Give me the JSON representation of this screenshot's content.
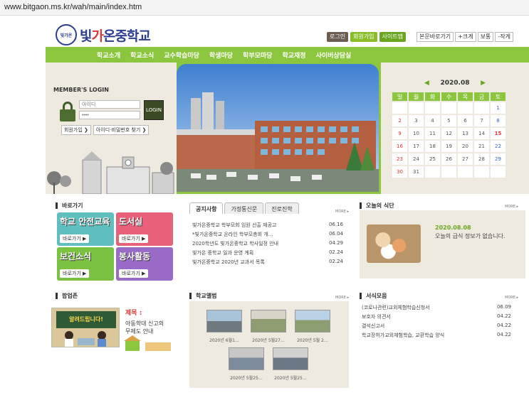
{
  "url": "www.bitgaon.ms.kr/wah/main/index.htm",
  "logo": {
    "emblem": "빛가온",
    "name_a": "빛",
    "name_b": "가",
    "name_c": "온중학교"
  },
  "top_links": [
    "로그인",
    "회원가입",
    "사이트맵"
  ],
  "tools": [
    "본문바로가기",
    "+크게",
    "보통",
    "-작게"
  ],
  "gnb": [
    "학교소개",
    "학교소식",
    "교수학습마당",
    "학생마당",
    "학부모마당",
    "학교재정",
    "사이버상담실"
  ],
  "login": {
    "title": "MEMBER'S LOGIN",
    "id_placeholder": "아이디",
    "pw_value": "••••",
    "button": "LOGIN",
    "join": "회원가입 ❯",
    "find": "아이디·비밀번호 찾기 ❯"
  },
  "calendar": {
    "month": "2020.08",
    "prev": "◀",
    "next": "▶",
    "weekdays": [
      "일",
      "월",
      "화",
      "수",
      "목",
      "금",
      "토"
    ],
    "rows": [
      [
        "",
        "",
        "",
        "",
        "",
        "",
        "1"
      ],
      [
        "2",
        "3",
        "4",
        "5",
        "6",
        "7",
        "8"
      ],
      [
        "9",
        "10",
        "11",
        "12",
        "13",
        "14",
        "15"
      ],
      [
        "16",
        "17",
        "18",
        "19",
        "20",
        "21",
        "22"
      ],
      [
        "23",
        "24",
        "25",
        "26",
        "27",
        "28",
        "29"
      ],
      [
        "30",
        "31",
        "",
        "",
        "",
        "",
        ""
      ]
    ]
  },
  "shortcuts": {
    "title": "바로가기",
    "items": [
      {
        "label": "학교 안전교육",
        "button": "바로가기 ▶",
        "color": "#5fbfbf"
      },
      {
        "label": "도서실",
        "button": "바로가기 ▶",
        "color": "#e8607a"
      },
      {
        "label": "보건소식",
        "button": "바로가기 ▶",
        "color": "#7bc142"
      },
      {
        "label": "봉사활동",
        "button": "바로가기 ▶",
        "color": "#9a6ac7"
      }
    ]
  },
  "notice": {
    "tabs": [
      "공지사항",
      "가정통신문",
      "진로진학"
    ],
    "more": "MORE ▸",
    "items": [
      {
        "title": "빛가온중학교 학부모회 임원 선출 재공고",
        "date": "06.16"
      },
      {
        "title": "*빛가온중학교 온라인 학부모총회 개…",
        "date": "06.04"
      },
      {
        "title": "2020학년도 빛가온중학교 학사일정 안내",
        "date": "04.29"
      },
      {
        "title": "빛가온 중학교 일과 운영 계획",
        "date": "02.24"
      },
      {
        "title": "빛가온중학교 2020년 교과서 목록",
        "date": "02.24"
      }
    ]
  },
  "meal": {
    "title": "오늘의 식단",
    "more": "MORE ▸",
    "date": "2020.08.08",
    "text": "오늘의 급식 정보가 없습니다."
  },
  "popup": {
    "title": "팝업존",
    "board": "알려드립니다!",
    "label": "제목 :",
    "text_1": "아동학대 신고의",
    "text_2": "무제도 안내"
  },
  "album": {
    "title": "학교앨범",
    "more": "MORE ▸",
    "captions": [
      "2020년 6월1…",
      "2020년 5월27…",
      "2020년 5월 2…",
      "2020년 5월25…",
      "2020년 5월25…"
    ]
  },
  "forms": {
    "title": "서식모음",
    "more": "MORE ▸",
    "items": [
      {
        "title": "(코로나관련)교외체험학습신청서",
        "date": "06.09"
      },
      {
        "title": "보호자 의견서",
        "date": "04.22"
      },
      {
        "title": "결석신고서",
        "date": "04.22"
      },
      {
        "title": "학교장허가교외체험학습, 교환학습 양식",
        "date": "04.22"
      }
    ]
  }
}
